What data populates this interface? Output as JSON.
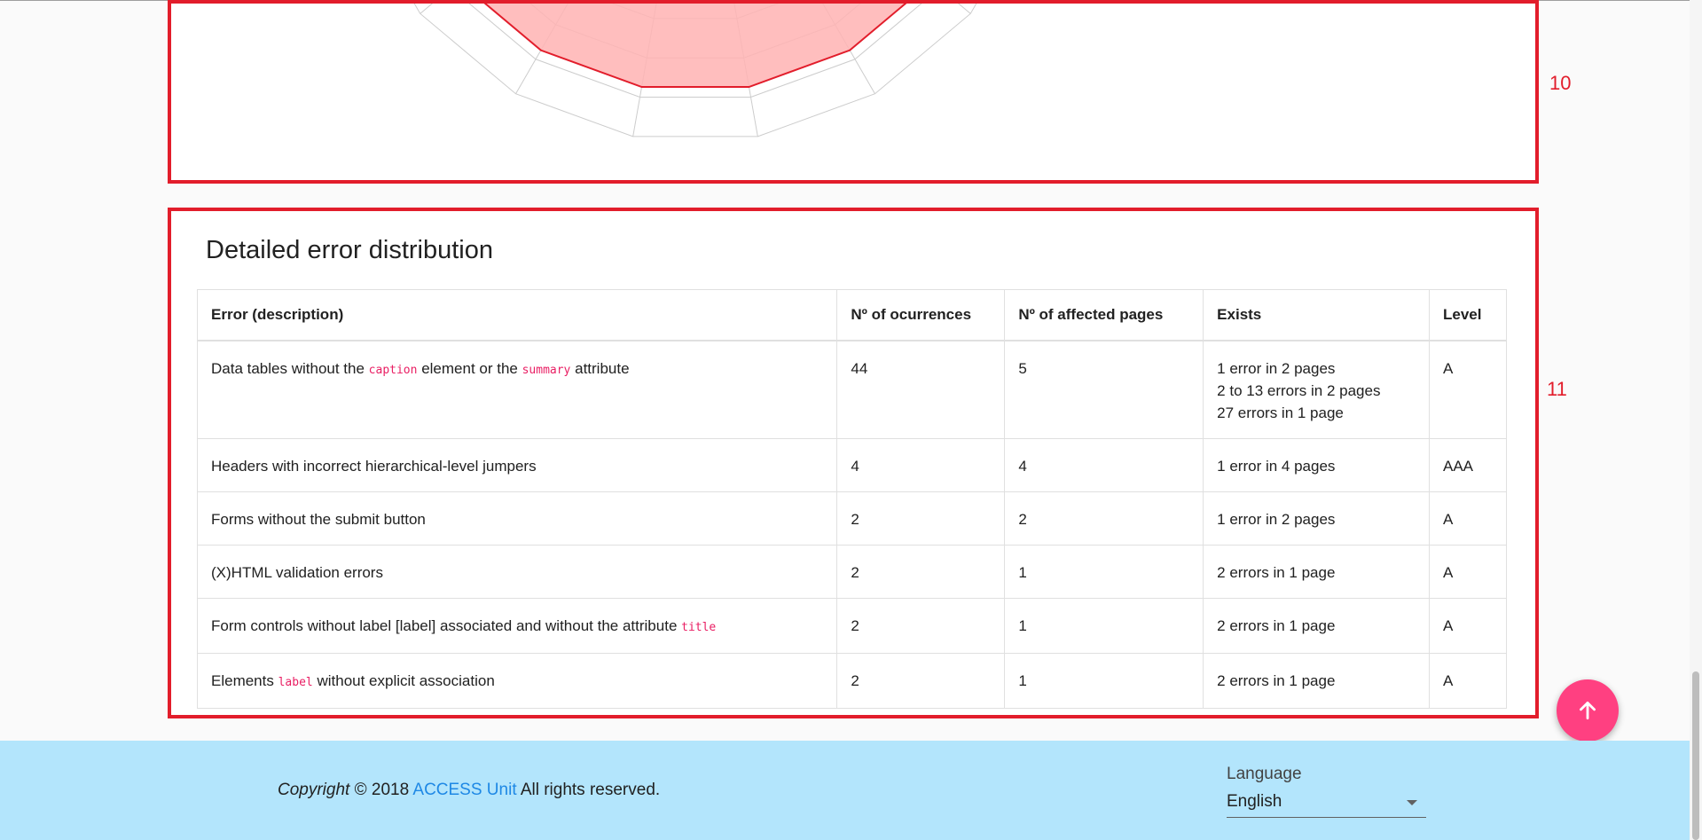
{
  "annotations": {
    "section_10": "10",
    "section_11": "11"
  },
  "radar": {
    "rings": 9,
    "spokes": 18,
    "colors": {
      "fill": "#ffb3b3",
      "stroke": "#e21d2b",
      "grid": "#cccccc"
    }
  },
  "detail": {
    "title": "Detailed error distribution",
    "columns": [
      "Error (description)",
      "Nº of ocurrences",
      "Nº of affected pages",
      "Exists",
      "Level"
    ],
    "rows": [
      {
        "desc_parts": [
          {
            "text": "Data tables without the "
          },
          {
            "code": "caption"
          },
          {
            "text": " element or the "
          },
          {
            "code": "summary"
          },
          {
            "text": " attribute"
          }
        ],
        "occurrences": "44",
        "pages": "5",
        "exists": [
          "1 error in 2 pages",
          "2 to 13 errors in 2 pages",
          "27 errors in 1 page"
        ],
        "level": "A"
      },
      {
        "desc_parts": [
          {
            "text": "Headers with incorrect hierarchical-level jumpers"
          }
        ],
        "occurrences": "4",
        "pages": "4",
        "exists": [
          "1 error in 4 pages"
        ],
        "level": "AAA"
      },
      {
        "desc_parts": [
          {
            "text": "Forms without the submit button"
          }
        ],
        "occurrences": "2",
        "pages": "2",
        "exists": [
          "1 error in 2 pages"
        ],
        "level": "A"
      },
      {
        "desc_parts": [
          {
            "text": "(X)HTML validation errors"
          }
        ],
        "occurrences": "2",
        "pages": "1",
        "exists": [
          "2 errors in 1 page"
        ],
        "level": "A"
      },
      {
        "desc_parts": [
          {
            "text": "Form controls without label [label] associated and without the attribute "
          },
          {
            "code": "title"
          }
        ],
        "occurrences": "2",
        "pages": "1",
        "exists": [
          "2 errors in 1 page"
        ],
        "level": "A"
      },
      {
        "desc_parts": [
          {
            "text": "Elements "
          },
          {
            "code": "label"
          },
          {
            "text": " without explicit association"
          }
        ],
        "occurrences": "2",
        "pages": "1",
        "exists": [
          "2 errors in 1 page"
        ],
        "level": "A"
      }
    ]
  },
  "fab": {
    "icon": "arrow-up-icon",
    "color": "#ff4081"
  },
  "footer": {
    "copyright_italic": "Copyright",
    "copyright_year": " © 2018 ",
    "link_text": "ACCESS Unit",
    "rights": " All rights reserved.",
    "language_label": "Language",
    "language_value": "English",
    "background": "#b3e5fc"
  }
}
